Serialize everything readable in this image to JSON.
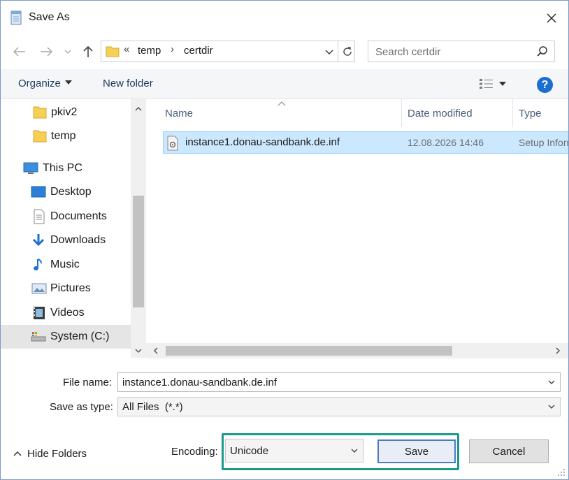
{
  "window": {
    "title": "Save As"
  },
  "address": {
    "overflow": "«",
    "crumbs": [
      "temp",
      "certdir"
    ]
  },
  "search": {
    "placeholder": "Search certdir"
  },
  "toolbar": {
    "organize": "Organize",
    "new_folder": "New folder",
    "help": "?"
  },
  "nav": {
    "items": [
      {
        "label": "pkiv2",
        "icon": "folder-icon"
      },
      {
        "label": "temp",
        "icon": "folder-icon"
      },
      {
        "label": "This PC",
        "icon": "computer-icon"
      },
      {
        "label": "Desktop",
        "icon": "desktop-icon"
      },
      {
        "label": "Documents",
        "icon": "documents-icon"
      },
      {
        "label": "Downloads",
        "icon": "downloads-icon"
      },
      {
        "label": "Music",
        "icon": "music-icon"
      },
      {
        "label": "Pictures",
        "icon": "pictures-icon"
      },
      {
        "label": "Videos",
        "icon": "videos-icon"
      },
      {
        "label": "System (C:)",
        "icon": "drive-icon",
        "selected": true
      }
    ]
  },
  "filelist": {
    "columns": [
      "Name",
      "Date modified",
      "Type"
    ],
    "files": [
      {
        "name": "instance1.donau-sandbank.de.inf",
        "date": "12.08.2026 14:46",
        "type": "Setup Information"
      }
    ]
  },
  "form": {
    "filename_label": "File name:",
    "filename_value": "instance1.donau-sandbank.de.inf",
    "savetype_label": "Save as type:",
    "savetype_value": "All Files  (*.*)",
    "encoding_label": "Encoding:",
    "encoding_value": "Unicode"
  },
  "buttons": {
    "hide_folders": "Hide Folders",
    "save": "Save",
    "cancel": "Cancel"
  },
  "colors": {
    "accent": "#1a6fd1",
    "selection": "#cce8ff",
    "highlight": "#1a9b8a"
  }
}
